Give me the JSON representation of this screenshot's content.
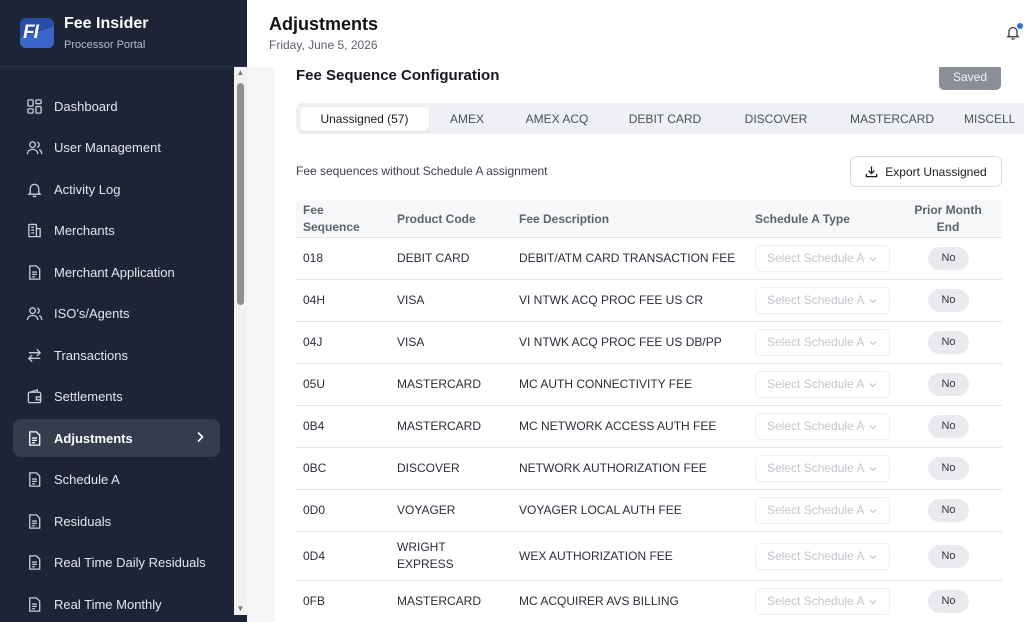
{
  "brand": {
    "title": "Fee Insider",
    "subtitle": "Processor Portal",
    "logo_text": "FI"
  },
  "sidebar": {
    "items": [
      {
        "label": "Dashboard",
        "icon": "dashboard-icon"
      },
      {
        "label": "User Management",
        "icon": "users-icon"
      },
      {
        "label": "Activity Log",
        "icon": "bell-icon"
      },
      {
        "label": "Merchants",
        "icon": "building-icon"
      },
      {
        "label": "Merchant Application",
        "icon": "document-icon"
      },
      {
        "label": "ISO's/Agents",
        "icon": "users-icon"
      },
      {
        "label": "Transactions",
        "icon": "arrows-icon"
      },
      {
        "label": "Settlements",
        "icon": "wallet-icon"
      },
      {
        "label": "Adjustments",
        "icon": "document-icon",
        "active": true
      },
      {
        "label": "Schedule A",
        "icon": "document-icon"
      },
      {
        "label": "Residuals",
        "icon": "document-icon"
      },
      {
        "label": "Real Time Daily Residuals",
        "icon": "document-icon"
      },
      {
        "label": "Real Time Monthly",
        "icon": "document-icon"
      }
    ]
  },
  "header": {
    "title": "Adjustments",
    "date": "Friday, June 5, 2026",
    "notification_dot_color": "#2f6fe0"
  },
  "section": {
    "title": "Fee Sequence Configuration",
    "saved_label": "Saved"
  },
  "tabs": [
    {
      "label": "Unassigned (57)",
      "active": true
    },
    {
      "label": "AMEX"
    },
    {
      "label": "AMEX ACQ"
    },
    {
      "label": "DEBIT CARD"
    },
    {
      "label": "DISCOVER"
    },
    {
      "label": "MASTERCARD"
    },
    {
      "label": "MISCELL"
    }
  ],
  "toolbar": {
    "description": "Fee sequences without Schedule A assignment",
    "export_label": "Export Unassigned"
  },
  "table": {
    "headers": {
      "seq": "Fee Sequence",
      "product": "Product Code",
      "description": "Fee Description",
      "schedule": "Schedule A Type",
      "prior": "Prior Month End"
    },
    "select_placeholder": "Select Schedule A",
    "rows": [
      {
        "seq": "018",
        "product": "DEBIT CARD",
        "description": "DEBIT/ATM CARD TRANSACTION FEE",
        "prior": "No"
      },
      {
        "seq": "04H",
        "product": "VISA",
        "description": "VI NTWK ACQ PROC FEE US CR",
        "prior": "No"
      },
      {
        "seq": "04J",
        "product": "VISA",
        "description": "VI NTWK ACQ PROC FEE US DB/PP",
        "prior": "No"
      },
      {
        "seq": "05U",
        "product": "MASTERCARD",
        "description": "MC AUTH CONNECTIVITY FEE",
        "prior": "No"
      },
      {
        "seq": "0B4",
        "product": "MASTERCARD",
        "description": "MC NETWORK ACCESS AUTH FEE",
        "prior": "No"
      },
      {
        "seq": "0BC",
        "product": "DISCOVER",
        "description": "NETWORK AUTHORIZATION FEE",
        "prior": "No"
      },
      {
        "seq": "0D0",
        "product": "VOYAGER",
        "description": "VOYAGER LOCAL AUTH FEE",
        "prior": "No"
      },
      {
        "seq": "0D4",
        "product": "WRIGHT EXPRESS",
        "description": "WEX AUTHORIZATION FEE",
        "prior": "No"
      },
      {
        "seq": "0FB",
        "product": "MASTERCARD",
        "description": "MC ACQUIRER AVS BILLING",
        "prior": "No"
      }
    ]
  }
}
